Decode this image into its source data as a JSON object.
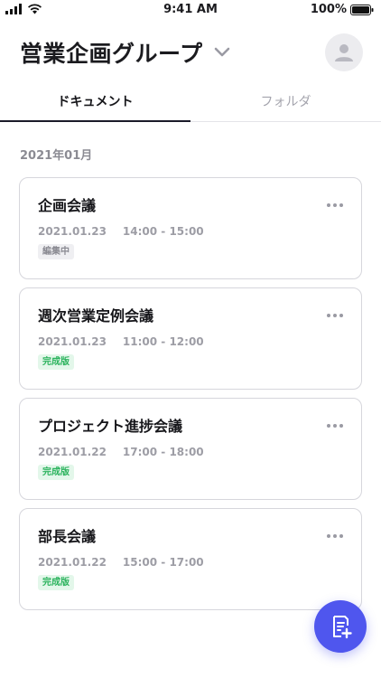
{
  "status_bar": {
    "time": "9:41 AM",
    "battery": "100%"
  },
  "header": {
    "group_name": "営業企画グループ"
  },
  "tabs": [
    {
      "label": "ドキュメント",
      "active": true
    },
    {
      "label": "フォルダ",
      "active": false
    }
  ],
  "section": {
    "month": "2021年01月"
  },
  "documents": [
    {
      "title": "企画会議",
      "date": "2021.01.23",
      "time": "14:00 - 15:00",
      "status": "編集中",
      "status_color": "gray"
    },
    {
      "title": "週次営業定例会議",
      "date": "2021.01.23",
      "time": "11:00 - 12:00",
      "status": "完成版",
      "status_color": "green"
    },
    {
      "title": "プロジェクト進捗会議",
      "date": "2021.01.22",
      "time": "17:00 - 18:00",
      "status": "完成版",
      "status_color": "green"
    },
    {
      "title": "部長会議",
      "date": "2021.01.22",
      "time": "15:00 - 17:00",
      "status": "完成版",
      "status_color": "green"
    }
  ],
  "colors": {
    "accent": "#4f56ee",
    "badge_green": "#2bb35d",
    "badge_gray": "#8a8a92"
  }
}
